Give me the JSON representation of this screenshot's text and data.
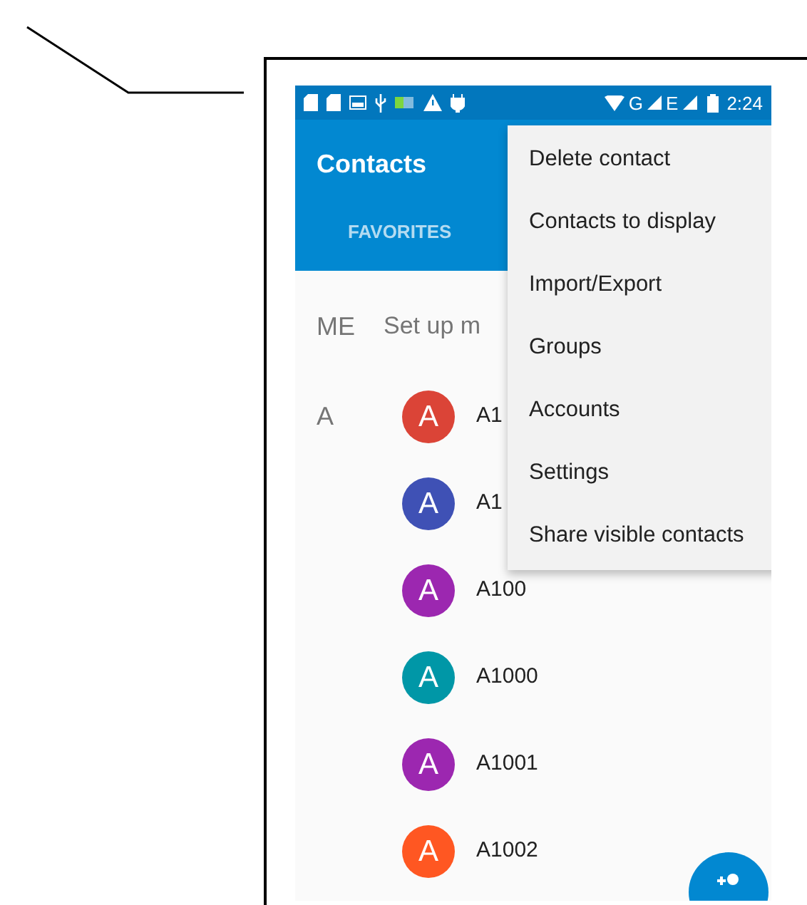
{
  "status_bar": {
    "network_labels": [
      "G",
      "E"
    ],
    "time": "2:24"
  },
  "app_bar": {
    "title": "Contacts",
    "tabs": [
      {
        "label": "FAVORITES",
        "selected": false
      }
    ]
  },
  "me_row": {
    "section": "ME",
    "text": "Set up m"
  },
  "sections": [
    {
      "letter": "A",
      "contacts": [
        {
          "initial": "A",
          "name": "A1",
          "color": "#db4437"
        },
        {
          "initial": "A",
          "name": "A1",
          "color": "#3f51b5"
        },
        {
          "initial": "A",
          "name": "A100",
          "color": "#9c27b0"
        },
        {
          "initial": "A",
          "name": "A1000",
          "color": "#0097a7"
        },
        {
          "initial": "A",
          "name": "A1001",
          "color": "#9c27b0"
        },
        {
          "initial": "A",
          "name": "A1002",
          "color": "#ff5722"
        }
      ]
    }
  ],
  "overflow_menu": {
    "items": [
      "Delete contact",
      "Contacts to display",
      "Import/Export",
      "Groups",
      "Accounts",
      "Settings",
      "Share visible contacts"
    ]
  }
}
